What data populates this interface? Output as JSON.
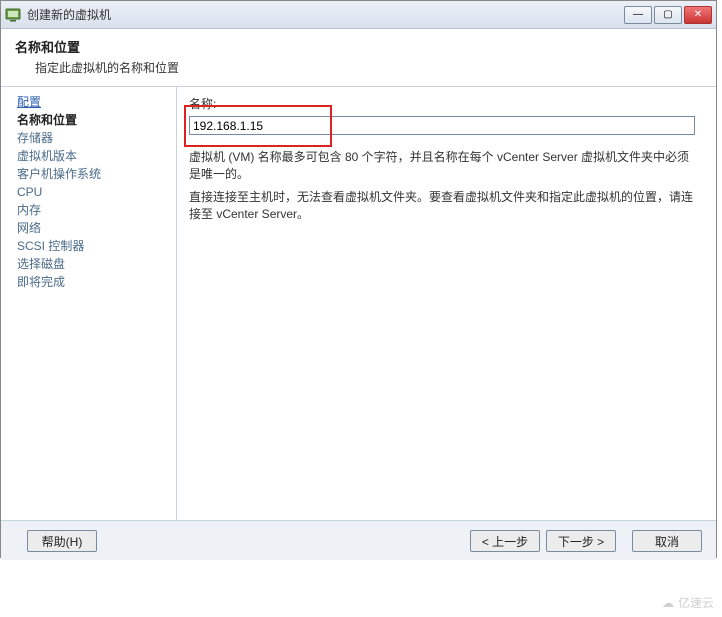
{
  "titlebar": {
    "title": "创建新的虚拟机"
  },
  "header": {
    "title": "名称和位置",
    "subtitle": "指定此虚拟机的名称和位置"
  },
  "nav": {
    "items": [
      {
        "label": "配置",
        "link": true
      },
      {
        "label": "名称和位置",
        "active": true
      },
      {
        "label": "存储器"
      },
      {
        "label": "虚拟机版本"
      },
      {
        "label": "客户机操作系统"
      },
      {
        "label": "CPU"
      },
      {
        "label": "内存"
      },
      {
        "label": "网络"
      },
      {
        "label": "SCSI 控制器"
      },
      {
        "label": "选择磁盘"
      },
      {
        "label": "即将完成"
      }
    ]
  },
  "form": {
    "name_label": "名称:",
    "name_value": "192.168.1.15",
    "hint1": "虚拟机 (VM) 名称最多可包含 80 个字符，并且名称在每个 vCenter Server 虚拟机文件夹中必须是唯一的。",
    "hint2": "直接连接至主机时，无法查看虚拟机文件夹。要查看虚拟机文件夹和指定此虚拟机的位置，请连接至 vCenter Server。"
  },
  "footer": {
    "help": "帮助(H)",
    "back": "< 上一步",
    "next": "下一步 >",
    "cancel": "取消"
  },
  "watermark": "亿速云"
}
